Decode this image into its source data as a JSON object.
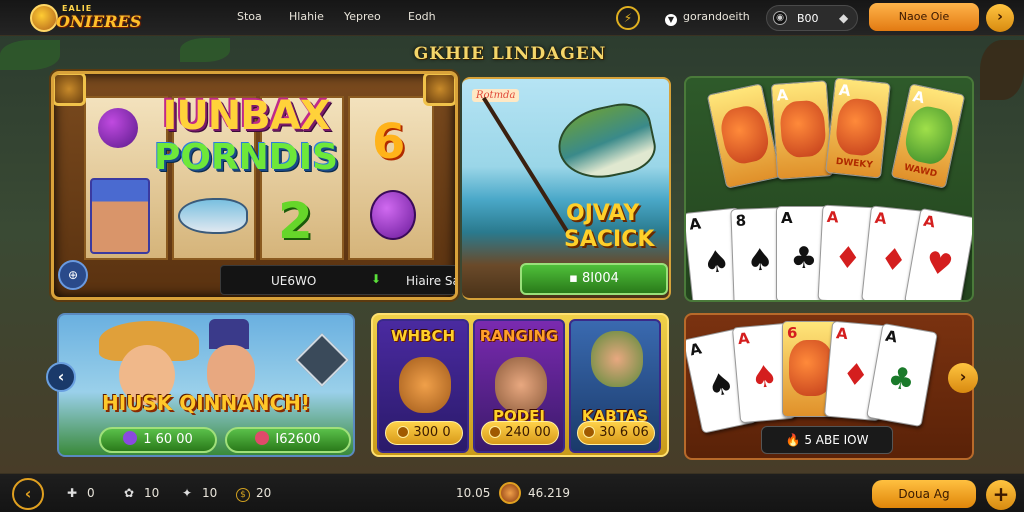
{
  "header": {
    "logo_top": "EALIE",
    "logo_main": "ONIERES",
    "nav": [
      "Stoa",
      "Hlahie",
      "Yepreo",
      "Eodh"
    ],
    "user": "gorandoeith",
    "balance": "B00",
    "deposit_label": "Naoe Oie"
  },
  "section_title": "GKHIE LINDAGEN",
  "slot": {
    "title_line1": "IUNBAX",
    "title_line2": "PORNDIS",
    "symbol_six": "6",
    "symbol_two": "2",
    "bar_left": "UE6WO",
    "bar_right": "Hiaire Satereae",
    "win": "8I004"
  },
  "fishing": {
    "tag": "Rotmda",
    "name_line1": "OJVAY",
    "name_line2": "SACICK"
  },
  "cards_top": [
    {
      "rank": "",
      "cap": "",
      "pic": true
    },
    {
      "rank": "A",
      "cap": "",
      "pic": true
    },
    {
      "rank": "A",
      "cap": "DWEKY",
      "pic": true
    },
    {
      "rank": "A",
      "cap": "WAWD",
      "pic": true
    },
    {
      "rank": "A",
      "suit": "♠",
      "color": "blk"
    },
    {
      "rank": "8",
      "suit": "♠",
      "color": "blk"
    },
    {
      "rank": "A",
      "suit": "♣",
      "color": "blk"
    },
    {
      "rank": "A",
      "suit": "♦",
      "color": "red"
    },
    {
      "rank": "A",
      "suit": "♦",
      "color": "red"
    },
    {
      "rank": "A",
      "suit": "♥",
      "color": "red"
    }
  ],
  "cards_bottom": [
    {
      "rank": "A",
      "suit": "♠",
      "color": "blk"
    },
    {
      "rank": "A",
      "suit": "♠",
      "color": "red"
    },
    {
      "rank": "6",
      "suit": "",
      "color": "red"
    },
    {
      "rank": "A",
      "suit": "♦",
      "color": "red"
    },
    {
      "rank": "A",
      "suit": "♣",
      "color": "blk"
    }
  ],
  "cards_chip": "5 ABE IOW",
  "adventure": {
    "title": "HIUSK QINNANCH!",
    "pill1": "1 60 00",
    "pill2": "I62600"
  },
  "trio": [
    {
      "name": "WHBCH",
      "price": "300 0"
    },
    {
      "name": "RANGING",
      "sub": "PODEI",
      "price": "240 00"
    },
    {
      "name": "KABTAS",
      "price": "30 6 06"
    }
  ],
  "footer": {
    "stats": [
      "0",
      "10",
      "10",
      "20"
    ],
    "left_value": "10.05",
    "right_value": "46.219",
    "play_label": "Doua Ag"
  }
}
